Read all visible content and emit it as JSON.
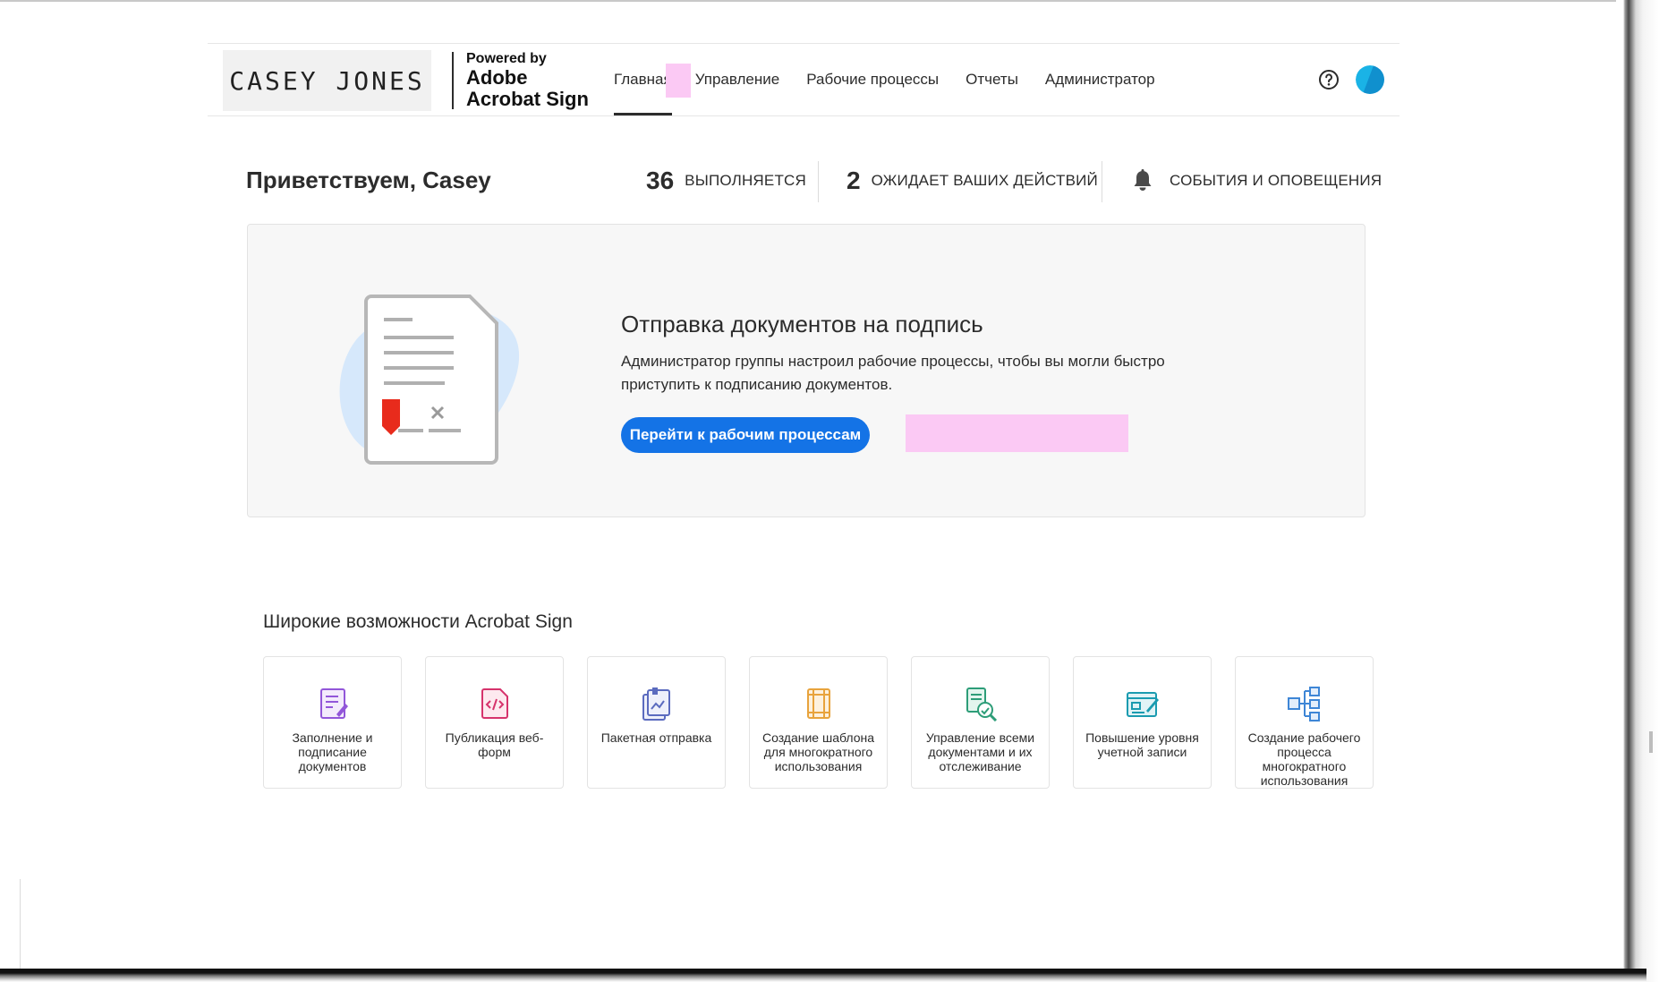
{
  "header": {
    "logo_text": "CASEY JONES",
    "brand_powered": "Powered by",
    "brand_line1": "Adobe",
    "brand_line2": "Acrobat Sign",
    "nav": [
      {
        "label": "Главная",
        "active": true
      },
      {
        "label": "Управление",
        "active": false
      },
      {
        "label": "Рабочие процессы",
        "active": false
      },
      {
        "label": "Отчеты",
        "active": false
      },
      {
        "label": "Администратор",
        "active": false
      }
    ],
    "help_icon": "question-circle-icon",
    "avatar_colors": [
      "#1ab3e6",
      "#0a7ec2"
    ]
  },
  "welcome": {
    "greeting": "Приветствуем, Casey",
    "in_progress_count": "36",
    "in_progress_label": "ВЫПОЛНЯЕТСЯ",
    "waiting_count": "2",
    "waiting_label": "ОЖИДАЕТ ВАШИХ ДЕЙСТВИЙ",
    "events_label": "СОБЫТИЯ И ОПОВЕЩЕНИЯ",
    "events_icon": "bell-icon"
  },
  "hero": {
    "title": "Отправка документов на подпись",
    "description": "Администратор группы настроил рабочие процессы, чтобы вы могли быстро приступить к подписанию документов.",
    "button_label": "Перейти к рабочим процессам",
    "accent": "#1473e6"
  },
  "features": {
    "title": "Широкие возможности Acrobat Sign",
    "tiles": [
      {
        "label": "Заполнение и подписание документов",
        "icon": "fill-sign-icon",
        "color": "#9256d9"
      },
      {
        "label": "Публикация веб-форм",
        "icon": "web-form-icon",
        "color": "#d6336c"
      },
      {
        "label": "Пакетная отправка",
        "icon": "bulk-send-icon",
        "color": "#5b6bbf"
      },
      {
        "label": "Создание шаблона для многократного использования",
        "icon": "template-icon",
        "color": "#e8a33c"
      },
      {
        "label": "Управление всеми документами и их отслеживание",
        "icon": "manage-track-icon",
        "color": "#2d9d78"
      },
      {
        "label": "Повышение уровня учетной записи",
        "icon": "upgrade-account-icon",
        "color": "#1a9bb0"
      },
      {
        "label": "Создание рабочего процесса многократного использования",
        "icon": "workflow-icon",
        "color": "#3e86d6"
      }
    ]
  }
}
